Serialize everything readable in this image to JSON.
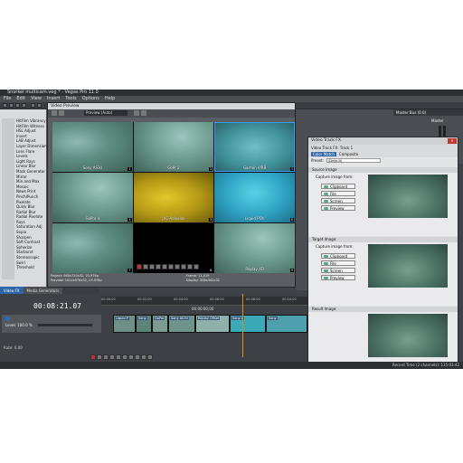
{
  "window": {
    "title": "Snorkel multicam.veg * - Vegas Pro 11.0",
    "menu": [
      "File",
      "Edit",
      "View",
      "Insert",
      "Tools",
      "Options",
      "Help"
    ]
  },
  "fx_panel": {
    "items": [
      "HitFilm Vibrancy",
      "HitFilm Witness",
      "HSL Adjust",
      "Invert",
      "LAB Adjust",
      "Layer Dimension",
      "Lens Flare",
      "Levels",
      "Light Rays",
      "Linear Blur",
      "Mask Generator",
      "Mirror",
      "Min and Max",
      "Mosaic",
      "News Print",
      "Pinch/Punch",
      "Pixelate",
      "Quick Blur",
      "Radial Blur",
      "Radial Pixelate",
      "Rays",
      "Saturation Adj",
      "Sepia",
      "Sharpen",
      "Soft Contrast",
      "Spherize",
      "Starburst",
      "Stereoscopic",
      "Swirl",
      "Threshold"
    ]
  },
  "bottom_tabs": {
    "video_fx": "Video FX",
    "media_generators": "Media Generators"
  },
  "video_preview": {
    "title": "Video Preview",
    "quality": "Preview (Auto)",
    "cells": [
      {
        "label": "Sony AS30",
        "num": "1"
      },
      {
        "label": "GoPr 2",
        "num": "2"
      },
      {
        "label": "Garmin VIRB",
        "num": "3"
      },
      {
        "label": "GoPro 4",
        "num": "4"
      },
      {
        "label": "JVC Adixxion",
        "num": "5"
      },
      {
        "label": "Liquid POV",
        "num": "6"
      },
      {
        "label": "",
        "num": "7"
      },
      {
        "label": "",
        "num": "8"
      },
      {
        "label": "Replay XD",
        "num": "9"
      }
    ],
    "project_info": "Project: 960x720x32, 23.976p",
    "preview_info": "Preview: 1024x576x32, 23.976p",
    "frame_info": "Frame: 11,019",
    "display_info": "Display: 356x342x32"
  },
  "master_bus": {
    "title": "Master Bus (0.0)",
    "master_label": "Master"
  },
  "video_track_fx": {
    "title": "Video Track FX",
    "track_label": "Video Track FX: Track 1",
    "chain": [
      "Color Match",
      "Composite"
    ],
    "preset_label": "Preset:",
    "preset_value": "(Default)",
    "source_header": "Source Image",
    "target_header": "Target Image:",
    "result_header": "Result Image:",
    "capture_label": "Capture image from:",
    "buttons": [
      "Clipboard",
      "File",
      "Screen",
      "Preview"
    ],
    "freeze_label": "Freeze"
  },
  "timeline": {
    "timecode": "00:08:21.07",
    "level": "Level: 100.0 %",
    "clip_labels": [
      "Liquid P",
      "Sony",
      "GoPro",
      "Sony AS30",
      "Sony A",
      "Replay Offset",
      "Sony"
    ],
    "ruler_ticks": [
      "00:00:00",
      "00:02:00",
      "00:04:00",
      "00:06:00",
      "00:08:00",
      "00:10:00"
    ],
    "rate": "Rate: 0.00",
    "preview_time": "00:00:00;00",
    "record_time": "Record Time (2 channels): 135:03:42"
  },
  "colors": {
    "accent_blue": "#2f66a8",
    "app_dark": "#3f4246",
    "playhead": "#e08a1c"
  }
}
